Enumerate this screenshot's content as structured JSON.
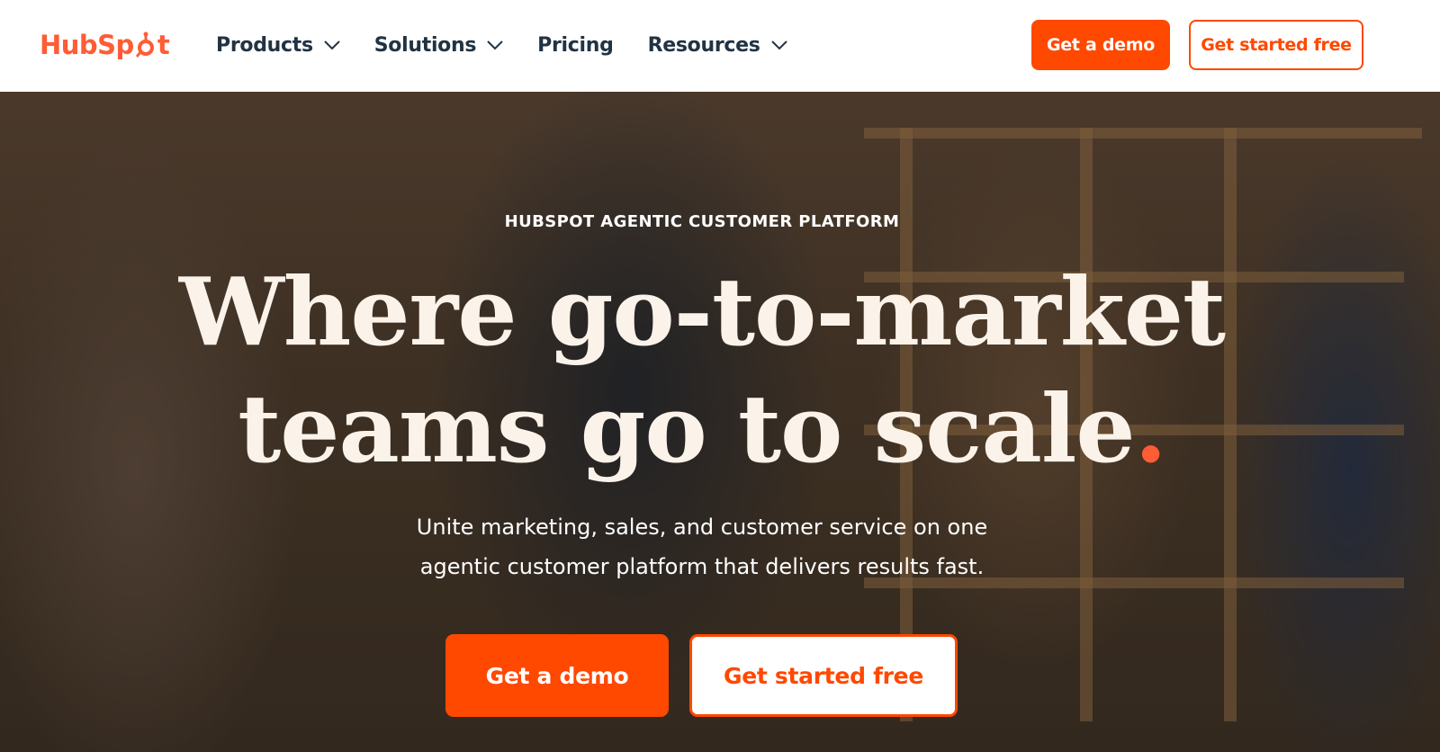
{
  "brand": {
    "logo_text_before": "HubSp",
    "logo_text_after": "t",
    "accent_color": "#ff4800"
  },
  "nav": {
    "items": [
      {
        "label": "Products",
        "has_dropdown": true
      },
      {
        "label": "Solutions",
        "has_dropdown": true
      },
      {
        "label": "Pricing",
        "has_dropdown": false
      },
      {
        "label": "Resources",
        "has_dropdown": true
      }
    ],
    "demo_label": "Get a demo",
    "free_label": "Get started free"
  },
  "hero": {
    "eyebrow": "HUBSPOT AGENTIC CUSTOMER PLATFORM",
    "headline_line1": "Where go-to-market",
    "headline_line2": "teams go to scale",
    "headline_dot": ".",
    "subtext": "Unite marketing, sales, and customer service on one agentic customer platform that delivers results fast.",
    "primary_cta": "Get a demo",
    "secondary_cta": "Get started free"
  }
}
